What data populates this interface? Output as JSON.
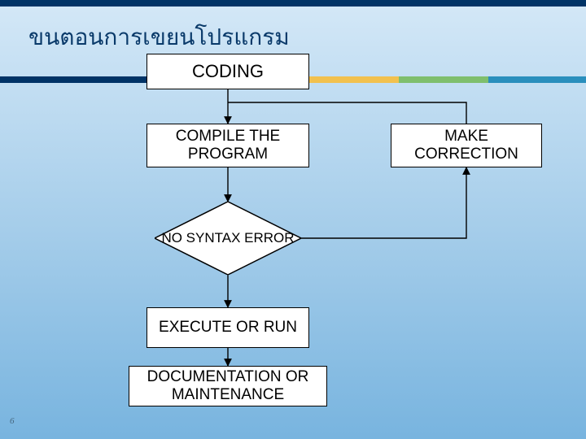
{
  "title": "ขนตอนการเขยนโปรแกรม",
  "page_number": "6",
  "flow": {
    "coding": "CODING",
    "compile": "COMPILE THE PROGRAM",
    "decision": "NO SYNTAX ERROR",
    "execute": "EXECUTE OR RUN",
    "doc": "DOCUMENTATION OR MAINTENANCE",
    "correction": "MAKE CORRECTION"
  },
  "chart_data": {
    "type": "flowchart",
    "title": "ขนตอนการเขยนโปรแกรม",
    "nodes": [
      {
        "id": "coding",
        "label": "CODING",
        "shape": "process"
      },
      {
        "id": "compile",
        "label": "COMPILE THE PROGRAM",
        "shape": "process"
      },
      {
        "id": "decision",
        "label": "NO SYNTAX ERROR",
        "shape": "decision"
      },
      {
        "id": "execute",
        "label": "EXECUTE OR RUN",
        "shape": "process"
      },
      {
        "id": "doc",
        "label": "DOCUMENTATION OR MAINTENANCE",
        "shape": "process"
      },
      {
        "id": "correction",
        "label": "MAKE CORRECTION",
        "shape": "process"
      }
    ],
    "edges": [
      {
        "from": "coding",
        "to": "compile"
      },
      {
        "from": "compile",
        "to": "decision"
      },
      {
        "from": "decision",
        "to": "execute"
      },
      {
        "from": "execute",
        "to": "doc"
      },
      {
        "from": "decision",
        "to": "correction"
      },
      {
        "from": "correction",
        "to": "compile"
      }
    ]
  }
}
